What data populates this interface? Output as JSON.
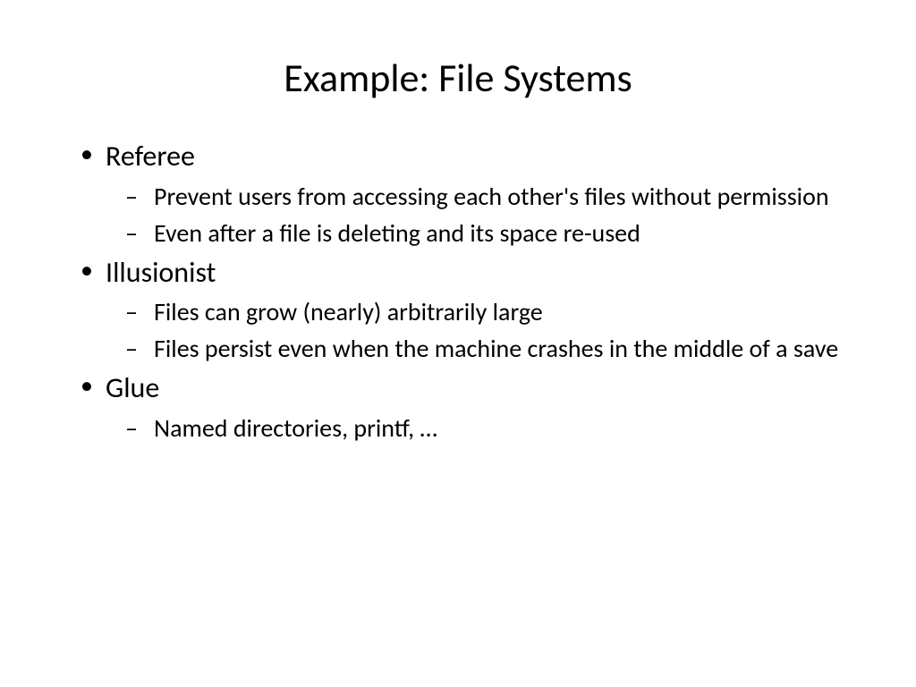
{
  "slide": {
    "title": "Example: File Systems",
    "bullets": [
      {
        "label": "Referee",
        "subitems": [
          "Prevent users from accessing each other's files without permission",
          "Even after a file is deleting and its space re-used"
        ]
      },
      {
        "label": "Illusionist",
        "subitems": [
          "Files can grow (nearly) arbitrarily large",
          "Files persist even when the machine crashes in the middle of a save"
        ]
      },
      {
        "label": "Glue",
        "subitems": [
          "Named directories, printf, …"
        ]
      }
    ]
  }
}
